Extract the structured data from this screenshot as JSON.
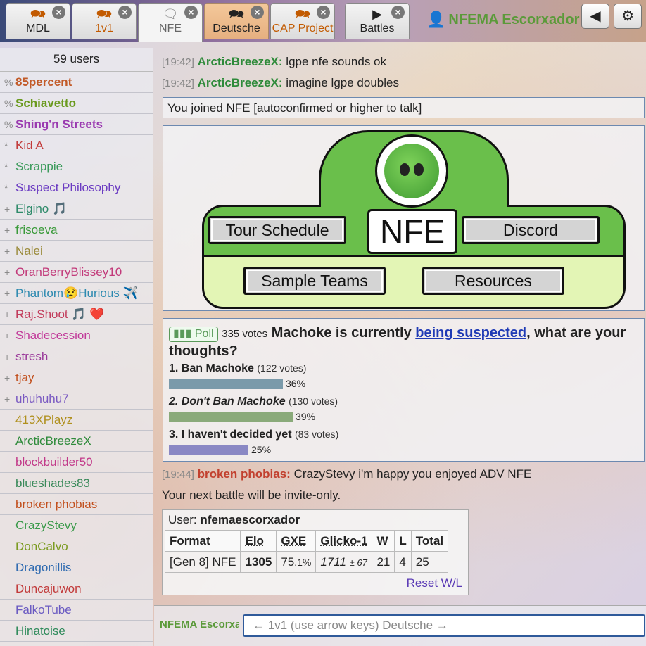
{
  "tabs": [
    {
      "label": "MDL",
      "icon": "chat-bubbles-icon",
      "state": "notify"
    },
    {
      "label": "1v1",
      "icon": "chat-bubbles-icon",
      "state": "notify"
    },
    {
      "label": "NFE",
      "icon": "chat-bubble-icon",
      "state": "active"
    },
    {
      "label": "Deutsche",
      "icon": "chat-bubbles-icon",
      "state": "highlight"
    },
    {
      "label": "CAP Project",
      "icon": "chat-bubbles-icon",
      "state": "notify"
    },
    {
      "label": "Battles",
      "icon": "play-box-icon",
      "state": "normal"
    }
  ],
  "current_user": {
    "name": "NFEMA Escorxador"
  },
  "userlist": {
    "count_text": "59 users",
    "users": [
      {
        "rank": "%",
        "name": "85percent",
        "color": "#c25a28",
        "bold": true
      },
      {
        "rank": "%",
        "name": "Schiavetto",
        "color": "#6a9a1e",
        "bold": true
      },
      {
        "rank": "%",
        "name": "Shing'n Streets",
        "color": "#9a3ab0",
        "bold": true
      },
      {
        "rank": "*",
        "name": "Kid A",
        "color": "#c23a3a",
        "bold": false
      },
      {
        "rank": "*",
        "name": "Scrappie",
        "color": "#3a9a5a",
        "bold": false
      },
      {
        "rank": "*",
        "name": "Suspect Philosophy",
        "color": "#6a3ac2",
        "bold": false
      },
      {
        "rank": "+",
        "name": "Elgino 🎵",
        "color": "#2e8a6a",
        "bold": false
      },
      {
        "rank": "+",
        "name": "frisoeva",
        "color": "#3a9a3a",
        "bold": false
      },
      {
        "rank": "+",
        "name": "Nalei",
        "color": "#9a8a3a",
        "bold": false
      },
      {
        "rank": "+",
        "name": "OranBerryBlissey10",
        "color": "#c23a7a",
        "bold": false
      },
      {
        "rank": "+",
        "name": "Phantom😢Hurious ✈️",
        "color": "#2e8ab0",
        "bold": false
      },
      {
        "rank": "+",
        "name": "Raj.Shoot 🎵 ❤️",
        "color": "#c23a5a",
        "bold": false
      },
      {
        "rank": "+",
        "name": "Shadecession",
        "color": "#c23a9a",
        "bold": false
      },
      {
        "rank": "+",
        "name": "stresh",
        "color": "#9a3a9a",
        "bold": false
      },
      {
        "rank": "+",
        "name": "tjay",
        "color": "#c2501e",
        "bold": false
      },
      {
        "rank": "+",
        "name": "uhuhuhu7",
        "color": "#7a5ac2",
        "bold": false
      },
      {
        "rank": "",
        "name": "413XPlayz",
        "color": "#b0901e",
        "bold": false
      },
      {
        "rank": "",
        "name": "ArcticBreezeX",
        "color": "#2e8a3a",
        "bold": false
      },
      {
        "rank": "",
        "name": "blockbuilder50",
        "color": "#c23a8a",
        "bold": false
      },
      {
        "rank": "",
        "name": "blueshades83",
        "color": "#3a8a5a",
        "bold": false
      },
      {
        "rank": "",
        "name": "broken phobias",
        "color": "#c2501e",
        "bold": false
      },
      {
        "rank": "",
        "name": "CrazyStevy",
        "color": "#3a9a4a",
        "bold": false
      },
      {
        "rank": "",
        "name": "DonCalvo",
        "color": "#7a9a1e",
        "bold": false
      },
      {
        "rank": "",
        "name": "Dragonillis",
        "color": "#2e6ab0",
        "bold": false
      },
      {
        "rank": "",
        "name": "Duncajuwon",
        "color": "#c23a3a",
        "bold": false
      },
      {
        "rank": "",
        "name": "FalkoTube",
        "color": "#6a5ac2",
        "bold": false
      },
      {
        "rank": "",
        "name": "Hinatoise",
        "color": "#2e8a5a",
        "bold": false
      }
    ]
  },
  "chat": {
    "lines": [
      {
        "time": "[19:42]",
        "author": "ArcticBreezeX:",
        "author_color": "#2e8a3a",
        "text": "lgpe nfe sounds ok"
      },
      {
        "time": "[19:42]",
        "author": "ArcticBreezeX:",
        "author_color": "#2e8a3a",
        "text": "imagine lgpe doubles"
      }
    ],
    "join_notice": "You joined NFE [autoconfirmed or higher to talk]",
    "banner": {
      "title": "NFE",
      "buttons": [
        "Tour Schedule",
        "Discord",
        "Sample Teams",
        "Resources"
      ]
    },
    "poll": {
      "badge": "Poll",
      "votes": "335 votes",
      "question_pre": "Machoke is currently ",
      "question_link": "being suspected",
      "question_post": ", what are your thoughts?",
      "options": [
        {
          "label": "1. Ban Machoke",
          "italic": false,
          "count": "(122 votes)",
          "percent": 36,
          "percent_text": "36%",
          "color": "#7a9aaa"
        },
        {
          "label": "2. Don't Ban Machoke",
          "italic": true,
          "count": "(130 votes)",
          "percent": 39,
          "percent_text": "39%",
          "color": "#8aaa7a"
        },
        {
          "label": "3. I haven't decided yet",
          "italic": false,
          "count": "(83 votes)",
          "percent": 25,
          "percent_text": "25%",
          "color": "#8a88c4"
        }
      ]
    },
    "later_line": {
      "time": "[19:44]",
      "author": "broken phobias:",
      "author_color": "#c2402e",
      "text": "CrazyStevy i'm happy you enjoyed ADV NFE"
    },
    "invite_notice": "Your next battle will be invite-only.",
    "stats": {
      "user_label": "User:",
      "username": "nfemaescorxador",
      "headers": [
        "Format",
        "Elo",
        "GXE",
        "Glicko-1",
        "W",
        "L",
        "Total"
      ],
      "row": {
        "format": "[Gen 8] NFE",
        "elo": "1305",
        "gxe_main": "75",
        "gxe_dec": ".1%",
        "glicko": "1711",
        "glicko_dev": "± 67",
        "w": "21",
        "l": "4",
        "total": "25"
      },
      "reset": "Reset W/L"
    }
  },
  "input": {
    "name": "NFEMA Escorxador",
    "placeholder": "← 1v1 (use arrow keys) Deutsche →"
  }
}
